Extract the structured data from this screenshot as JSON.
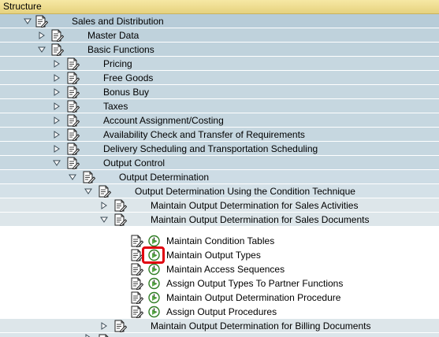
{
  "header": {
    "title": "Structure"
  },
  "nodes": [
    {
      "label": "Sales and Distribution",
      "expanded": true
    },
    {
      "label": "Master Data",
      "expanded": false
    },
    {
      "label": "Basic Functions",
      "expanded": true
    },
    {
      "label": "Pricing",
      "expanded": false
    },
    {
      "label": "Free Goods",
      "expanded": false
    },
    {
      "label": "Bonus Buy",
      "expanded": false
    },
    {
      "label": "Taxes",
      "expanded": false
    },
    {
      "label": "Account Assignment/Costing",
      "expanded": false
    },
    {
      "label": "Availability Check and Transfer of Requirements",
      "expanded": false
    },
    {
      "label": "Delivery Scheduling and Transportation Scheduling",
      "expanded": false
    },
    {
      "label": "Output Control",
      "expanded": true
    },
    {
      "label": "Output Determination",
      "expanded": true
    },
    {
      "label": "Output Determination Using the Condition Technique",
      "expanded": true
    },
    {
      "label": "Maintain Output Determination for Sales Activities",
      "expanded": false
    },
    {
      "label": "Maintain Output Determination for Sales Documents",
      "expanded": true
    },
    {
      "label": "Maintain Condition Tables",
      "type": "activity"
    },
    {
      "label": "Maintain Output Types",
      "type": "activity",
      "highlighted": true
    },
    {
      "label": "Maintain Access Sequences",
      "type": "activity"
    },
    {
      "label": "Assign Output Types To Partner Functions",
      "type": "activity"
    },
    {
      "label": "Maintain Output Determination Procedure",
      "type": "activity"
    },
    {
      "label": "Assign Output Procedures",
      "type": "activity"
    },
    {
      "label": "Maintain Output Determination for Billing Documents",
      "expanded": false
    }
  ],
  "colors": {
    "header_bg": "#f0de8e",
    "folder_row_bg": "#c6d7e0",
    "highlight_border": "#e0000e",
    "clock_green": "#3f9a2c"
  },
  "icons": {
    "expanded": "triangle-down-icon",
    "collapsed": "triangle-right-icon",
    "node": "document-icon",
    "activity": "execute-clock-icon"
  }
}
